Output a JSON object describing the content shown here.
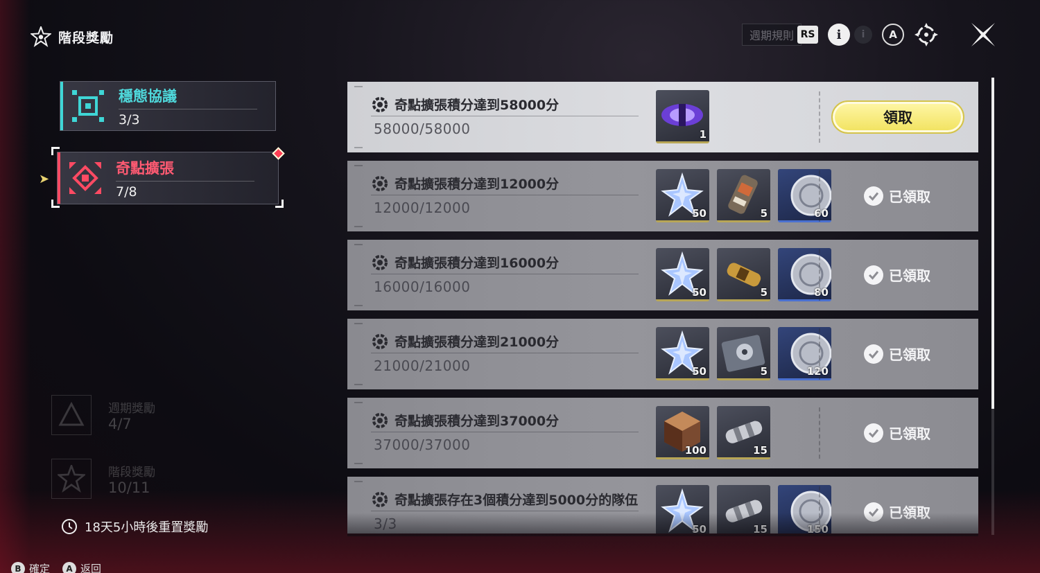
{
  "header": {
    "title": "階段獎勵"
  },
  "top_bar": {
    "cycle_rules_label": "週期規則",
    "rs_label": "RS",
    "info_label": "i",
    "a_label": "A"
  },
  "nav": {
    "items": [
      {
        "label": "穩態協議",
        "progress": "3/3",
        "accent": "#3fd6d6"
      },
      {
        "label": "奇點擴張",
        "progress": "7/8",
        "accent": "#ff4a63"
      }
    ],
    "dim_items": [
      {
        "label": "週期獎勵",
        "progress": "4/7"
      },
      {
        "label": "階段獎勵",
        "progress": "10/11"
      }
    ]
  },
  "reset_text": "18天5小時後重置獎勵",
  "hints": [
    {
      "key": "B",
      "label": "確定"
    },
    {
      "key": "A",
      "label": "返回"
    }
  ],
  "rewards": [
    {
      "title": "奇點擴張積分達到58000分",
      "progress": "58000/58000",
      "status": "claim",
      "action_label": "領取",
      "items": [
        {
          "icon": "purple-capsule-icon",
          "count": "1",
          "rarity": "gold"
        }
      ]
    },
    {
      "title": "奇點擴張積分達到12000分",
      "progress": "12000/12000",
      "status": "claimed",
      "action_label": "已領取",
      "items": [
        {
          "icon": "star-crystal-icon",
          "count": "50",
          "rarity": "gold"
        },
        {
          "icon": "module-part-icon",
          "count": "5",
          "rarity": "gold"
        },
        {
          "icon": "silver-coin-icon",
          "count": "60",
          "rarity": "blue"
        }
      ]
    },
    {
      "title": "奇點擴張積分達到16000分",
      "progress": "16000/16000",
      "status": "claimed",
      "action_label": "已領取",
      "items": [
        {
          "icon": "star-crystal-icon",
          "count": "50",
          "rarity": "gold"
        },
        {
          "icon": "gold-cylinder-icon",
          "count": "5",
          "rarity": "gold"
        },
        {
          "icon": "silver-coin-icon",
          "count": "80",
          "rarity": "blue"
        }
      ]
    },
    {
      "title": "奇點擴張積分達到21000分",
      "progress": "21000/21000",
      "status": "claimed",
      "action_label": "已領取",
      "items": [
        {
          "icon": "star-crystal-icon",
          "count": "50",
          "rarity": "gold"
        },
        {
          "icon": "hard-drive-icon",
          "count": "5",
          "rarity": "gold"
        },
        {
          "icon": "silver-coin-icon",
          "count": "120",
          "rarity": "blue"
        }
      ]
    },
    {
      "title": "奇點擴張積分達到37000分",
      "progress": "37000/37000",
      "status": "claimed",
      "action_label": "已領取",
      "items": [
        {
          "icon": "cube-crystal-icon",
          "count": "100",
          "rarity": "gold"
        },
        {
          "icon": "silver-cylinder-icon",
          "count": "15",
          "rarity": "gold"
        }
      ]
    },
    {
      "title": "奇點擴張存在3個積分達到5000分的隊伍",
      "progress": "3/3",
      "status": "claimed",
      "action_label": "已領取",
      "items": [
        {
          "icon": "star-crystal-icon",
          "count": "50",
          "rarity": "gold"
        },
        {
          "icon": "silver-cylinder-icon",
          "count": "15",
          "rarity": "gold"
        },
        {
          "icon": "silver-coin-icon",
          "count": "150",
          "rarity": "blue"
        }
      ]
    }
  ],
  "colors": {
    "claim_button": "#f1e25e",
    "accent_cyan": "#3fd6d6",
    "accent_red": "#ff4a63"
  }
}
